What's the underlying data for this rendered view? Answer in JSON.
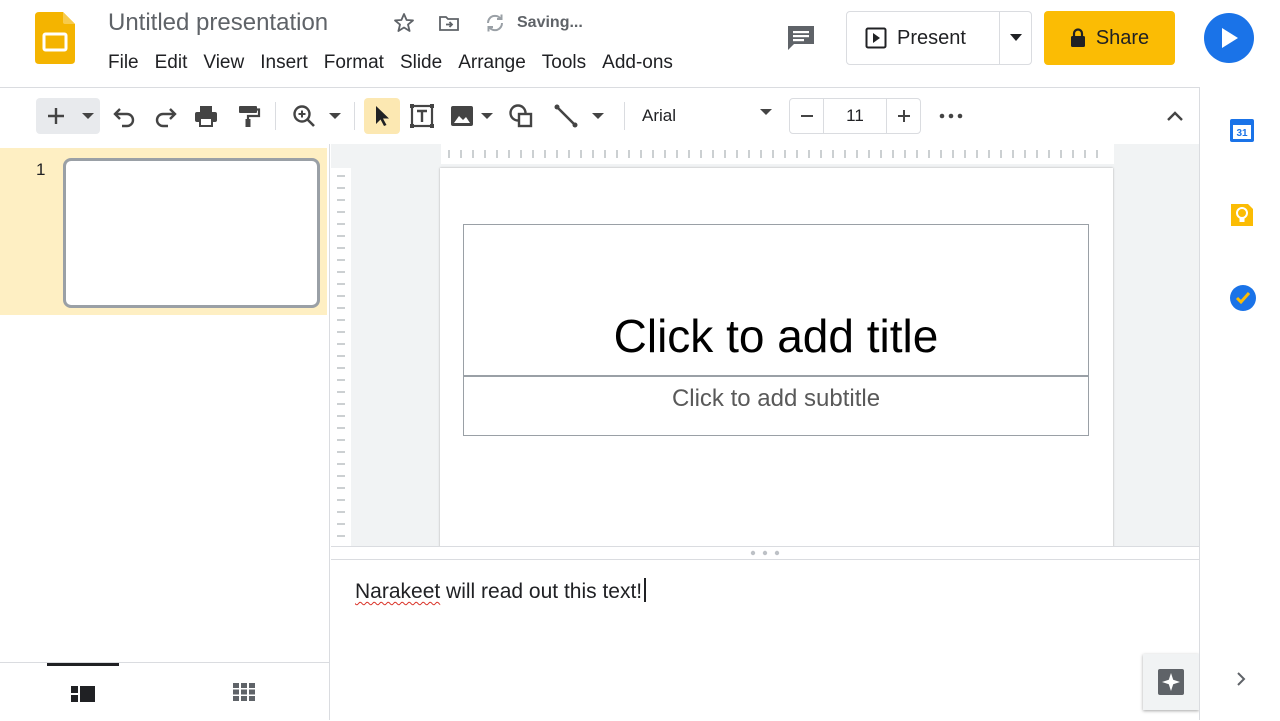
{
  "header": {
    "doc_title": "Untitled presentation",
    "status": "Saving...",
    "menu": [
      "File",
      "Edit",
      "View",
      "Insert",
      "Format",
      "Slide",
      "Arrange",
      "Tools",
      "Add-ons"
    ],
    "present_label": "Present",
    "share_label": "Share"
  },
  "toolbar": {
    "font_name": "Arial",
    "font_size": "11"
  },
  "filmstrip": {
    "slides": [
      {
        "number": "1"
      }
    ]
  },
  "slide": {
    "title_placeholder": "Click to add title",
    "subtitle_placeholder": "Click to add subtitle"
  },
  "notes": {
    "first_word": "Narakeet",
    "rest": " will read out this text!"
  },
  "side_panel": {
    "calendar_day": "31"
  },
  "colors": {
    "share": "#fbbc04",
    "meet": "#1a73e8",
    "selection": "#feefc3",
    "keep": "#fbbc04"
  }
}
